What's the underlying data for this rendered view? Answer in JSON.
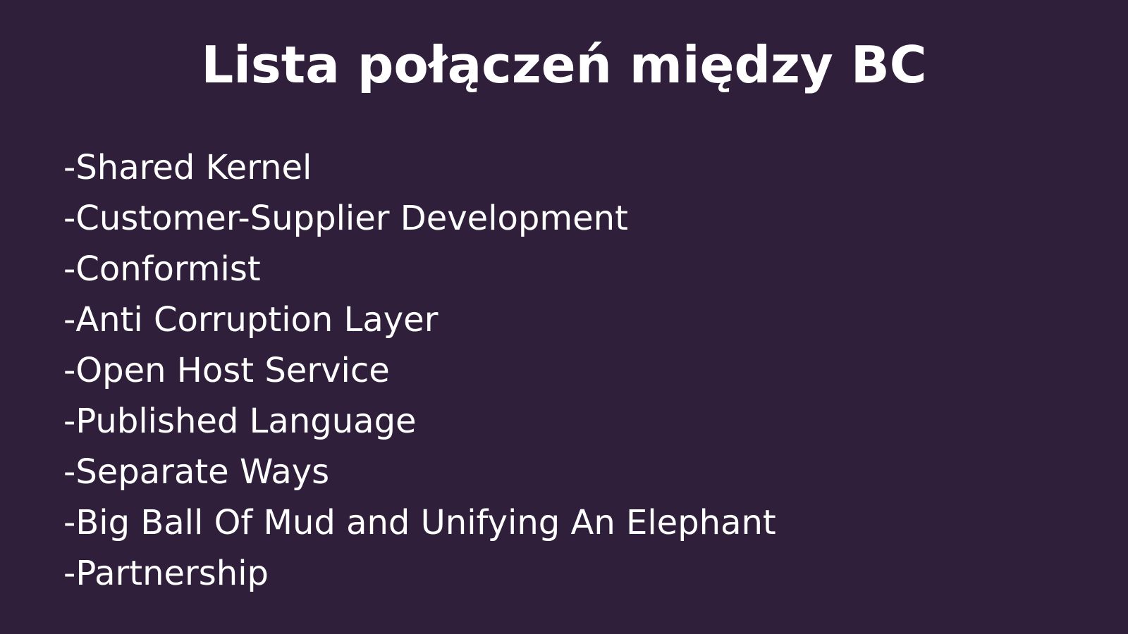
{
  "slide": {
    "title": "Lista połączeń między BC",
    "bullet_prefix": "- ",
    "items": [
      "Shared Kernel",
      "Customer-Supplier Development",
      "Conformist",
      "Anti Corruption Layer",
      "Open Host Service",
      "Published Language",
      "Separate Ways",
      "Big Ball Of Mud and Unifying An Elephant",
      "Partnership"
    ],
    "colors": {
      "background": "#2f1f3b",
      "text": "#ffffff"
    }
  }
}
